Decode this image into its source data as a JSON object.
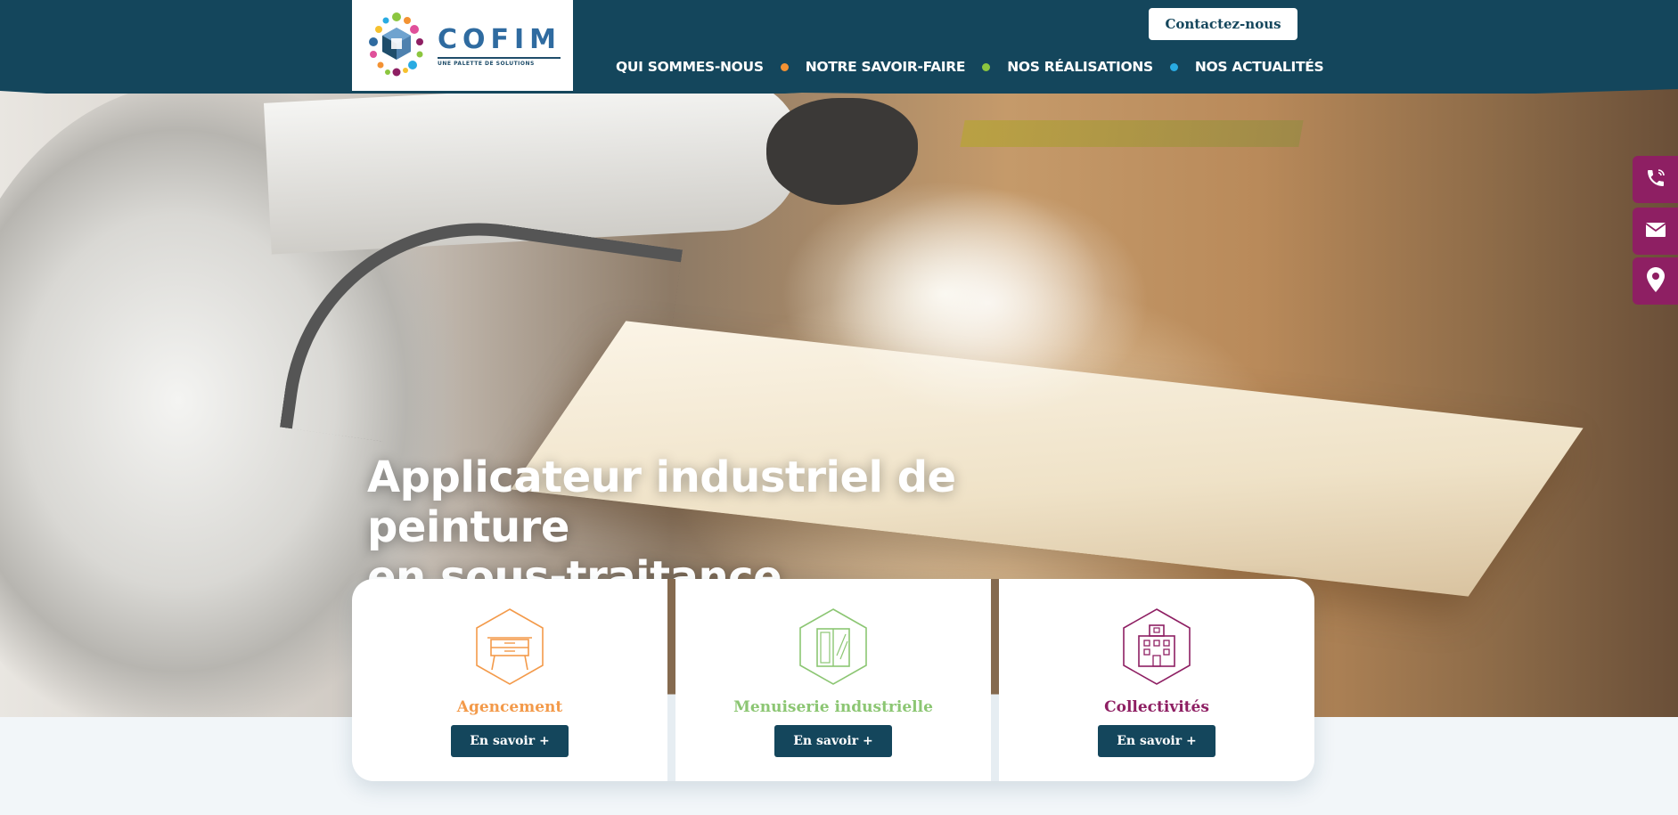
{
  "header": {
    "logo_name": "COFIM",
    "logo_tagline": "UNE PALETTE DE SOLUTIONS",
    "contact_label": "Contactez-nous"
  },
  "nav": {
    "items": [
      {
        "label": "QUI SOMMES-NOUS"
      },
      {
        "label": "NOTRE SAVOIR-FAIRE"
      },
      {
        "label": "NOS RÉALISATIONS"
      },
      {
        "label": "NOS ACTUALITÉS"
      }
    ],
    "dot_colors": [
      "#f39233",
      "#8cc63f",
      "#29abe2"
    ]
  },
  "side_bar": {
    "icons": [
      "phone-icon",
      "mail-icon",
      "location-icon"
    ],
    "color": "#8e1f63"
  },
  "hero": {
    "title_line1": "Applicateur industriel de peinture",
    "title_line2": "en sous-traitance"
  },
  "cards": [
    {
      "title": "Agencement",
      "button": "En savoir +",
      "color": "#f39a4a",
      "icon": "furniture-icon"
    },
    {
      "title": "Menuiserie industrielle",
      "button": "En savoir +",
      "color": "#8cc673",
      "icon": "window-icon"
    },
    {
      "title": "Collectivités",
      "button": "En savoir +",
      "color": "#8e1f63",
      "icon": "building-icon"
    }
  ],
  "colors": {
    "brand_dark": "#14465c",
    "accent_purple": "#8e1f63"
  }
}
